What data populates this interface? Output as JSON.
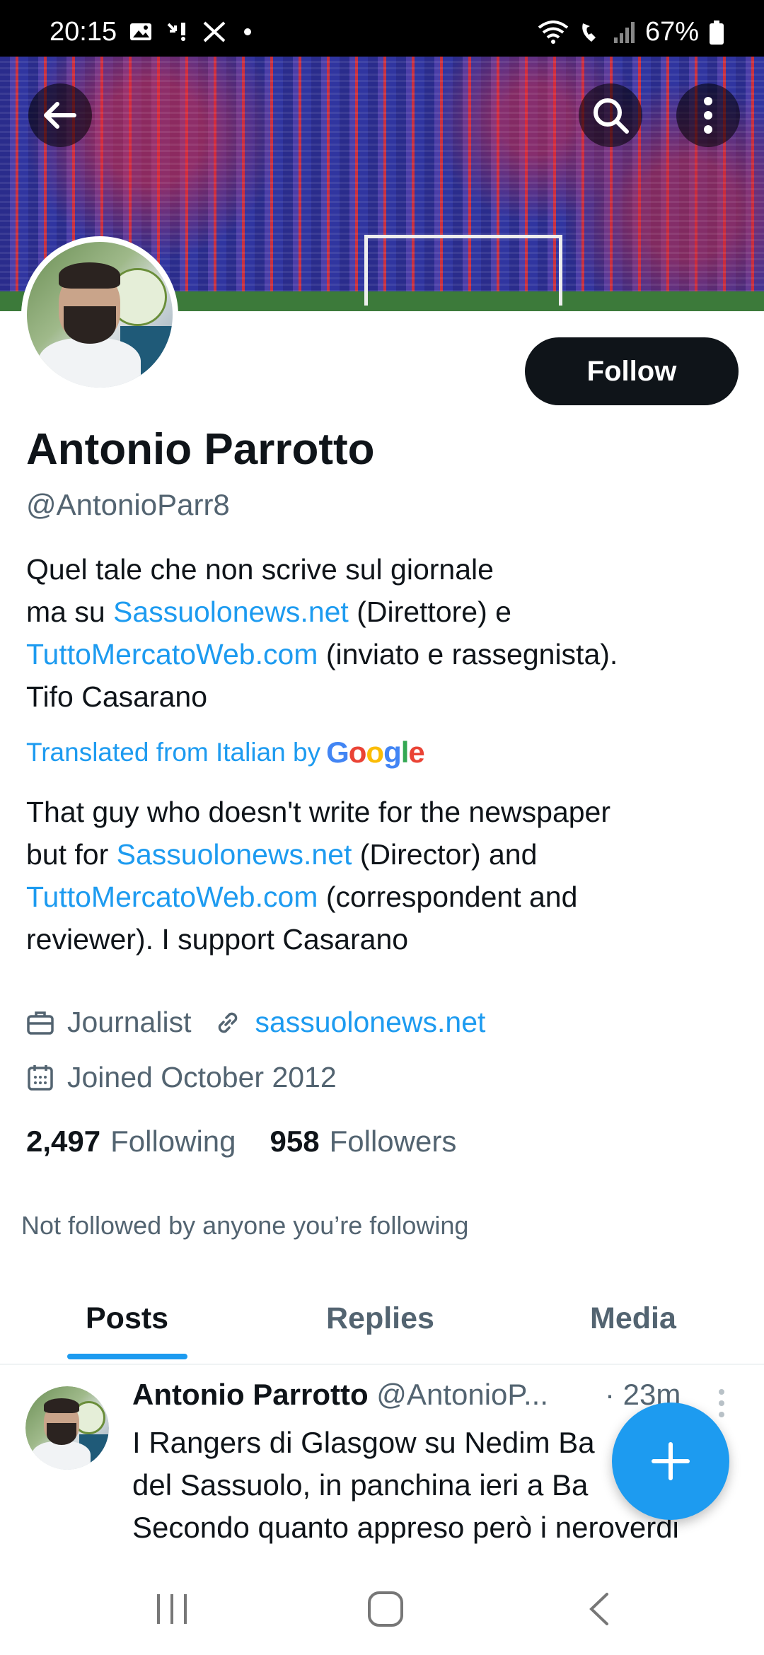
{
  "status_bar": {
    "time": "20:15",
    "battery": "67%"
  },
  "profile": {
    "name": "Antonio Parrotto",
    "handle": "@AntonioParr8",
    "follow_label": "Follow",
    "bio": {
      "line1": "Quel tale che non scrive sul giornale",
      "line2_pre": "ma su ",
      "link1": "Sassuolonews.net",
      "line2_post": " (Direttore) e",
      "link2": "TuttoMercatoWeb.com",
      "line3_post": " (inviato e rassegnista).",
      "line4": "Tifo Casarano"
    },
    "translated_label": "Translated from Italian by",
    "translator_brand": "Google",
    "bio_translated": {
      "line1": "That guy who doesn't write for the newspaper",
      "line2_pre": "but for ",
      "link1": "Sassuolonews.net",
      "line2_post": " (Director) and",
      "link2": "TuttoMercatoWeb.com",
      "line3_post": " (correspondent and",
      "line4": "reviewer). I support Casarano"
    },
    "profession": "Journalist",
    "website": "sassuolonews.net",
    "joined": "Joined October 2012",
    "following_count": "2,497",
    "following_label": "Following",
    "followers_count": "958",
    "followers_label": "Followers",
    "not_followed_text": "Not followed by anyone you’re following"
  },
  "tabs": [
    {
      "label": "Posts",
      "active": true
    },
    {
      "label": "Replies",
      "active": false
    },
    {
      "label": "Media",
      "active": false
    }
  ],
  "post": {
    "author": "Antonio Parrotto",
    "handle": "@AntonioP...",
    "time": "· 23m",
    "lines": [
      "I Rangers di Glasgow su Nedim Ba",
      "del Sassuolo, in panchina ieri a Ba",
      "Secondo quanto appreso però i neroverdi"
    ]
  },
  "icons": {
    "back": "arrow-left-icon",
    "search": "search-icon",
    "more": "more-vertical-icon",
    "compose": "plus-icon",
    "briefcase": "briefcase-icon",
    "link": "link-icon",
    "calendar": "calendar-icon"
  },
  "colors": {
    "accent": "#1d9bf0",
    "text": "#0f1419",
    "muted": "#536471"
  }
}
